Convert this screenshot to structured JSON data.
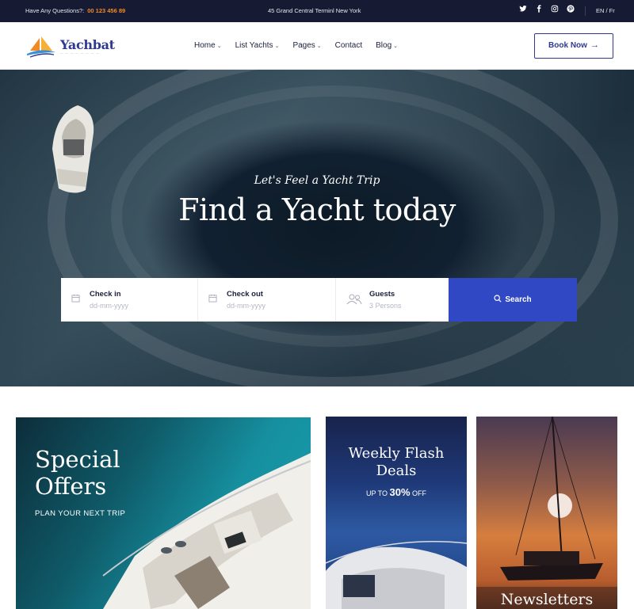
{
  "topbar": {
    "question": "Have Any Questions?:",
    "phone": "00 123 456 89",
    "address": "45 Grand Central Terminl New York",
    "social_icons": [
      "twitter-icon",
      "facebook-icon",
      "instagram-icon",
      "pinterest-icon"
    ],
    "language": "EN / Fr"
  },
  "header": {
    "brand": "Yachbat",
    "nav": [
      {
        "label": "Home",
        "dropdown": true
      },
      {
        "label": "List Yachts",
        "dropdown": true
      },
      {
        "label": "Pages",
        "dropdown": true
      },
      {
        "label": "Contact",
        "dropdown": false
      },
      {
        "label": "Blog",
        "dropdown": true
      }
    ],
    "book_label": "Book Now"
  },
  "hero": {
    "tagline": "Let's Feel a Yacht Trip",
    "title": "Find a Yacht today",
    "search": {
      "checkin_label": "Check in",
      "checkin_placeholder": "dd-mm-yyyy",
      "checkout_label": "Check out",
      "checkout_placeholder": "dd-mm-yyyy",
      "guests_label": "Guests",
      "guests_placeholder": "3  Persons",
      "button_label": "Search"
    }
  },
  "cards": {
    "special": {
      "title_line1": "Special",
      "title_line2": "Offers",
      "subtitle": "PLAN YOUR NEXT TRIP"
    },
    "flash": {
      "title_line1": "Weekly Flash",
      "title_line2": "Deals",
      "prefix": "UP TO",
      "percent": "30%",
      "suffix": "OFF"
    },
    "newsletter": {
      "title": "Newsletters"
    }
  },
  "colors": {
    "primary": "#3048c4",
    "dark": "#161a33",
    "accent": "#f08a24"
  }
}
